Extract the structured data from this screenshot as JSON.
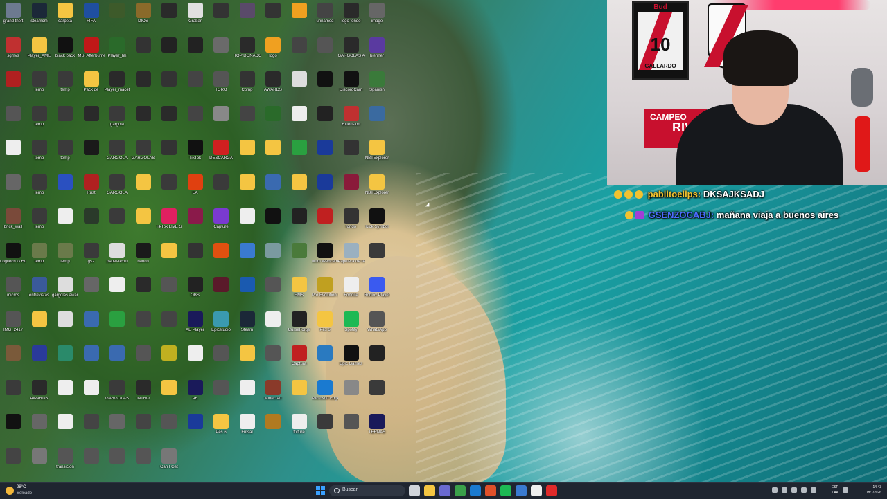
{
  "desktop": {
    "icons": [
      {
        "label": "grand theft",
        "color": "#6d7a90"
      },
      {
        "label": "steamcm",
        "color": "#1b2838"
      },
      {
        "label": "carpeta",
        "color": "#f4c542"
      },
      {
        "label": "FIFA",
        "color": "#1f4fa0"
      },
      {
        "label": "",
        "color": "#3d5a2a"
      },
      {
        "label": "DIOS",
        "color": "#8a6a2a"
      },
      {
        "label": "",
        "color": "#2a2a2a"
      },
      {
        "label": "Grabar",
        "color": "#e0e0e0"
      },
      {
        "label": "",
        "color": "#333"
      },
      {
        "label": "",
        "color": "#5a4a6a"
      },
      {
        "label": "",
        "color": "#333"
      },
      {
        "label": "",
        "color": "#f0a020"
      },
      {
        "label": "unnamed",
        "color": "#444"
      },
      {
        "label": "logo fondo",
        "color": "#2a2a2a"
      },
      {
        "label": "image",
        "color": "#666"
      },
      {
        "label": "sgmvs",
        "color": "#c03030"
      },
      {
        "label": "Player_AME",
        "color": "#f4c542"
      },
      {
        "label": "black back",
        "color": "#111"
      },
      {
        "label": "MSI Afterburner",
        "color": "#c01818"
      },
      {
        "label": "Player_hh",
        "color": "#2a6a2a"
      },
      {
        "label": "",
        "color": "#333"
      },
      {
        "label": "",
        "color": "#222"
      },
      {
        "label": "",
        "color": "#222"
      },
      {
        "label": "",
        "color": "#6a6a6a"
      },
      {
        "label": "TOP DONADOR",
        "color": "#2a2a2a"
      },
      {
        "label": "logo",
        "color": "#f0a020"
      },
      {
        "label": "",
        "color": "#444"
      },
      {
        "label": "",
        "color": "#555"
      },
      {
        "label": "GARGOLAS AWARDS",
        "color": "#2a2a2a"
      },
      {
        "label": "bienner",
        "color": "#5a3aa0"
      },
      {
        "label": "",
        "color": "#b02020"
      },
      {
        "label": "temp",
        "color": "#3a3a3a"
      },
      {
        "label": "temp",
        "color": "#3a3a3a"
      },
      {
        "label": "Pack de",
        "color": "#f4c542"
      },
      {
        "label": "Player_macet",
        "color": "#2a2a2a"
      },
      {
        "label": "",
        "color": "#2a2a2a"
      },
      {
        "label": "",
        "color": "#333"
      },
      {
        "label": "",
        "color": "#444"
      },
      {
        "label": "TORO",
        "color": "#555"
      },
      {
        "label": "Comp",
        "color": "#333"
      },
      {
        "label": "AWARDS",
        "color": "#2a2a2a"
      },
      {
        "label": "",
        "color": "#ddd"
      },
      {
        "label": "",
        "color": "#111"
      },
      {
        "label": "DiscordCam",
        "color": "#111"
      },
      {
        "label": "Spanish",
        "color": "#3a7a3a"
      },
      {
        "label": "",
        "color": "#555"
      },
      {
        "label": "temp",
        "color": "#3a3a3a"
      },
      {
        "label": "",
        "color": "#3a3a3a"
      },
      {
        "label": "",
        "color": "#2a2a2a"
      },
      {
        "label": "gargola",
        "color": "#3a3a3a"
      },
      {
        "label": "",
        "color": "#2a2a2a"
      },
      {
        "label": "",
        "color": "#2a2a2a"
      },
      {
        "label": "",
        "color": "#444"
      },
      {
        "label": "",
        "color": "#888"
      },
      {
        "label": "",
        "color": "#444"
      },
      {
        "label": "",
        "color": "#2a6a2a"
      },
      {
        "label": "",
        "color": "#eee"
      },
      {
        "label": "",
        "color": "#222"
      },
      {
        "label": "Extension",
        "color": "#c03030"
      },
      {
        "label": "",
        "color": "#3a6aa0"
      },
      {
        "label": "",
        "color": "#eee"
      },
      {
        "label": "temp",
        "color": "#3a3a3a"
      },
      {
        "label": "temp",
        "color": "#3a3a3a"
      },
      {
        "label": "",
        "color": "#1a1a1a"
      },
      {
        "label": "GARGOLA",
        "color": "#3a3a3a"
      },
      {
        "label": "GARGOLAS",
        "color": "#3a3a3a"
      },
      {
        "label": "",
        "color": "#333"
      },
      {
        "label": "TikTok",
        "color": "#111"
      },
      {
        "label": "DESCARGA",
        "color": "#d02020"
      },
      {
        "label": "",
        "color": "#f4c542"
      },
      {
        "label": "",
        "color": "#f4c542"
      },
      {
        "label": "",
        "color": "#2aa040"
      },
      {
        "label": "",
        "color": "#1a3a9a"
      },
      {
        "label": "",
        "color": "#333"
      },
      {
        "label": "NBTExplorer",
        "color": "#f4c542"
      },
      {
        "label": "",
        "color": "#666"
      },
      {
        "label": "temp",
        "color": "#3a3a3a"
      },
      {
        "label": "",
        "color": "#2a50c0"
      },
      {
        "label": "Rust",
        "color": "#b02020"
      },
      {
        "label": "GARGOLA",
        "color": "#3a3a3a"
      },
      {
        "label": "",
        "color": "#f4c542"
      },
      {
        "label": "",
        "color": "#3a3a3a"
      },
      {
        "label": "EA",
        "color": "#e04010"
      },
      {
        "label": "",
        "color": "#3a3a3a"
      },
      {
        "label": "",
        "color": "#f4c542"
      },
      {
        "label": "",
        "color": "#3a6ab0"
      },
      {
        "label": "",
        "color": "#f4c542"
      },
      {
        "label": "",
        "color": "#1a3a9a"
      },
      {
        "label": "",
        "color": "#8a1a3a"
      },
      {
        "label": "NBTExplorer",
        "color": "#f4c542"
      },
      {
        "label": "brick_wall",
        "color": "#7a4a3a"
      },
      {
        "label": "temp",
        "color": "#3a3a3a"
      },
      {
        "label": "",
        "color": "#eee"
      },
      {
        "label": "",
        "color": "#2a3a2a"
      },
      {
        "label": "",
        "color": "#3a3a3a"
      },
      {
        "label": "",
        "color": "#f4c542"
      },
      {
        "label": "TikTok LIVE Studio",
        "color": "#e02060"
      },
      {
        "label": "",
        "color": "#8a1a4a"
      },
      {
        "label": "Capture",
        "color": "#7a3ad0"
      },
      {
        "label": "",
        "color": "#eee"
      },
      {
        "label": "",
        "color": "#111"
      },
      {
        "label": "",
        "color": "#222"
      },
      {
        "label": "",
        "color": "#c02020"
      },
      {
        "label": "fondo",
        "color": "#333"
      },
      {
        "label": "Kick-Symbol",
        "color": "#111"
      },
      {
        "label": "Logitech G HUB",
        "color": "#111"
      },
      {
        "label": "temp",
        "color": "#6a7a4a"
      },
      {
        "label": "temp",
        "color": "#6a7a4a"
      },
      {
        "label": "gs2",
        "color": "#3a3a3a"
      },
      {
        "label": "papel-textu",
        "color": "#ddd"
      },
      {
        "label": "banco",
        "color": "#1a1a1a"
      },
      {
        "label": "",
        "color": "#f4c542"
      },
      {
        "label": "",
        "color": "#333"
      },
      {
        "label": "",
        "color": "#e05010"
      },
      {
        "label": "",
        "color": "#3a7ad0"
      },
      {
        "label": "",
        "color": "#7a9aa0"
      },
      {
        "label": "",
        "color": "#4a7a3a"
      },
      {
        "label": "Ilium Webcam",
        "color": "#111"
      },
      {
        "label": "Papelera de reciclaje",
        "color": "#9ab0c0"
      },
      {
        "label": "",
        "color": "#3a3a3a"
      },
      {
        "label": "micros",
        "color": "#555"
      },
      {
        "label": "entrevistas",
        "color": "#3a5a9a"
      },
      {
        "label": "gargolas awards",
        "color": "#ddd"
      },
      {
        "label": "",
        "color": "#666"
      },
      {
        "label": "",
        "color": "#eee"
      },
      {
        "label": "",
        "color": "#2a2a2a"
      },
      {
        "label": "",
        "color": "#555"
      },
      {
        "label": "OBS",
        "color": "#222"
      },
      {
        "label": "",
        "color": "#5a1a2a"
      },
      {
        "label": "",
        "color": "#1a5ab0"
      },
      {
        "label": "",
        "color": "#555"
      },
      {
        "label": "HMS",
        "color": "#f4c542"
      },
      {
        "label": "Pro Evolution Soccer 6",
        "color": "#c0a020"
      },
      {
        "label": "Fortnite",
        "color": "#eee"
      },
      {
        "label": "Roblox Player",
        "color": "#3a5af0"
      },
      {
        "label": "IMG_2417",
        "color": "#555"
      },
      {
        "label": "",
        "color": "#f4c542"
      },
      {
        "label": "",
        "color": "#ddd"
      },
      {
        "label": "",
        "color": "#3a6ab0"
      },
      {
        "label": "",
        "color": "#2aa040"
      },
      {
        "label": "",
        "color": "#444"
      },
      {
        "label": "",
        "color": "#444"
      },
      {
        "label": "AE Player",
        "color": "#1a1a5a"
      },
      {
        "label": "Epicstudio",
        "color": "#3a9ab0"
      },
      {
        "label": "Steam",
        "color": "#1b2838"
      },
      {
        "label": "",
        "color": "#eee"
      },
      {
        "label": "CurseForge",
        "color": "#222"
      },
      {
        "label": "Pes 6",
        "color": "#f4c542"
      },
      {
        "label": "Spotify",
        "color": "#1db954"
      },
      {
        "label": "WhatsApp",
        "color": "#555"
      },
      {
        "label": "",
        "color": "#7a5a3a"
      },
      {
        "label": "",
        "color": "#2a3a9a"
      },
      {
        "label": "",
        "color": "#2a8a6a"
      },
      {
        "label": "",
        "color": "#3a6ab0"
      },
      {
        "label": "",
        "color": "#3a6ab0"
      },
      {
        "label": "",
        "color": "#555"
      },
      {
        "label": "",
        "color": "#c0b020"
      },
      {
        "label": "",
        "color": "#eee"
      },
      {
        "label": "",
        "color": "#555"
      },
      {
        "label": "",
        "color": "#f4c542"
      },
      {
        "label": "",
        "color": "#555"
      },
      {
        "label": "Captura",
        "color": "#c02020"
      },
      {
        "label": "",
        "color": "#2a7ac0"
      },
      {
        "label": "Epic Games",
        "color": "#111"
      },
      {
        "label": "",
        "color": "#222"
      },
      {
        "label": "",
        "color": "#3a3a3a"
      },
      {
        "label": "AWARDS",
        "color": "#2a2a2a"
      },
      {
        "label": "",
        "color": "#eee"
      },
      {
        "label": "",
        "color": "#eee"
      },
      {
        "label": "GARGOLAS",
        "color": "#3a3a3a"
      },
      {
        "label": "INTRO",
        "color": "#2a2a2a"
      },
      {
        "label": "",
        "color": "#f4c542"
      },
      {
        "label": "AE",
        "color": "#1a1a5a"
      },
      {
        "label": "",
        "color": "#555"
      },
      {
        "label": "",
        "color": "#eee"
      },
      {
        "label": "Minecraft",
        "color": "#8a3a2a"
      },
      {
        "label": "",
        "color": "#f4c542"
      },
      {
        "label": "Microsoft Edge",
        "color": "#1a7ad0"
      },
      {
        "label": "",
        "color": "#888"
      },
      {
        "label": "",
        "color": "#3a3a3a"
      },
      {
        "label": "",
        "color": "#111"
      },
      {
        "label": "",
        "color": "#666"
      },
      {
        "label": "",
        "color": "#eee"
      },
      {
        "label": "",
        "color": "#444"
      },
      {
        "label": "",
        "color": "#666"
      },
      {
        "label": "",
        "color": "#444"
      },
      {
        "label": "",
        "color": "#555"
      },
      {
        "label": "",
        "color": "#1a3a9a"
      },
      {
        "label": "Pes 6",
        "color": "#f4c542"
      },
      {
        "label": "Futsal",
        "color": "#eee"
      },
      {
        "label": "",
        "color": "#b07a20"
      },
      {
        "label": "fixture",
        "color": "#eee"
      },
      {
        "label": "",
        "color": "#3a3a3a"
      },
      {
        "label": "",
        "color": "#555"
      },
      {
        "label": "TERNAS",
        "color": "#1a1a5a"
      },
      {
        "label": "",
        "color": "#444"
      },
      {
        "label": "",
        "color": "#777"
      },
      {
        "label": "transicion",
        "color": "#555"
      },
      {
        "label": "",
        "color": "#555"
      },
      {
        "label": "",
        "color": "#555"
      },
      {
        "label": "",
        "color": "#555"
      },
      {
        "label": "Can I Get",
        "color": "#777"
      }
    ]
  },
  "webcam": {
    "jersey_brand": "Bud",
    "jersey_number": "10",
    "jersey_name": "GALLARDO",
    "flag_text_top": "CAMPEO",
    "flag_text_bottom": "RIV"
  },
  "chat": {
    "messages": [
      {
        "user": "pabiitoelips:",
        "text": "DKSAJKSADJ"
      },
      {
        "user": "GSENZOCABJ:",
        "text": "mañana viaja a buenos aires"
      }
    ]
  },
  "taskbar": {
    "weather_temp": "28°C",
    "weather_desc": "Soleado",
    "search_placeholder": "Buscar",
    "lang_code": "ESP",
    "lang_layout": "LAA",
    "time": "14:43",
    "date": "18/1/2026",
    "apps": [
      {
        "name": "task-view-icon",
        "color": "#d0d4da"
      },
      {
        "name": "file-explorer-icon",
        "color": "#f4c542"
      },
      {
        "name": "teams-icon",
        "color": "#6a6ad0"
      },
      {
        "name": "chrome-icon",
        "color": "#3aa04a"
      },
      {
        "name": "edge-icon",
        "color": "#1a7ad0"
      },
      {
        "name": "brave-icon",
        "color": "#e0502a"
      },
      {
        "name": "spotify-icon",
        "color": "#1db954"
      },
      {
        "name": "store-icon",
        "color": "#3a7ad0"
      },
      {
        "name": "capcut-icon",
        "color": "#eeeeee"
      },
      {
        "name": "obs-icon",
        "color": "#e02a2a"
      }
    ]
  }
}
